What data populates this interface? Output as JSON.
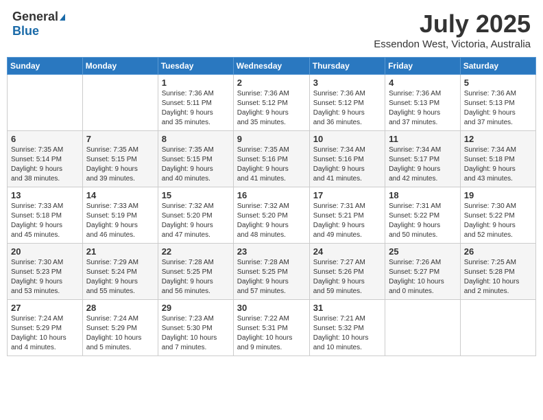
{
  "header": {
    "logo_general": "General",
    "logo_blue": "Blue",
    "month": "July 2025",
    "location": "Essendon West, Victoria, Australia"
  },
  "weekdays": [
    "Sunday",
    "Monday",
    "Tuesday",
    "Wednesday",
    "Thursday",
    "Friday",
    "Saturday"
  ],
  "weeks": [
    [
      {
        "day": "",
        "info": ""
      },
      {
        "day": "",
        "info": ""
      },
      {
        "day": "1",
        "info": "Sunrise: 7:36 AM\nSunset: 5:11 PM\nDaylight: 9 hours\nand 35 minutes."
      },
      {
        "day": "2",
        "info": "Sunrise: 7:36 AM\nSunset: 5:12 PM\nDaylight: 9 hours\nand 35 minutes."
      },
      {
        "day": "3",
        "info": "Sunrise: 7:36 AM\nSunset: 5:12 PM\nDaylight: 9 hours\nand 36 minutes."
      },
      {
        "day": "4",
        "info": "Sunrise: 7:36 AM\nSunset: 5:13 PM\nDaylight: 9 hours\nand 37 minutes."
      },
      {
        "day": "5",
        "info": "Sunrise: 7:36 AM\nSunset: 5:13 PM\nDaylight: 9 hours\nand 37 minutes."
      }
    ],
    [
      {
        "day": "6",
        "info": "Sunrise: 7:35 AM\nSunset: 5:14 PM\nDaylight: 9 hours\nand 38 minutes."
      },
      {
        "day": "7",
        "info": "Sunrise: 7:35 AM\nSunset: 5:15 PM\nDaylight: 9 hours\nand 39 minutes."
      },
      {
        "day": "8",
        "info": "Sunrise: 7:35 AM\nSunset: 5:15 PM\nDaylight: 9 hours\nand 40 minutes."
      },
      {
        "day": "9",
        "info": "Sunrise: 7:35 AM\nSunset: 5:16 PM\nDaylight: 9 hours\nand 41 minutes."
      },
      {
        "day": "10",
        "info": "Sunrise: 7:34 AM\nSunset: 5:16 PM\nDaylight: 9 hours\nand 41 minutes."
      },
      {
        "day": "11",
        "info": "Sunrise: 7:34 AM\nSunset: 5:17 PM\nDaylight: 9 hours\nand 42 minutes."
      },
      {
        "day": "12",
        "info": "Sunrise: 7:34 AM\nSunset: 5:18 PM\nDaylight: 9 hours\nand 43 minutes."
      }
    ],
    [
      {
        "day": "13",
        "info": "Sunrise: 7:33 AM\nSunset: 5:18 PM\nDaylight: 9 hours\nand 45 minutes."
      },
      {
        "day": "14",
        "info": "Sunrise: 7:33 AM\nSunset: 5:19 PM\nDaylight: 9 hours\nand 46 minutes."
      },
      {
        "day": "15",
        "info": "Sunrise: 7:32 AM\nSunset: 5:20 PM\nDaylight: 9 hours\nand 47 minutes."
      },
      {
        "day": "16",
        "info": "Sunrise: 7:32 AM\nSunset: 5:20 PM\nDaylight: 9 hours\nand 48 minutes."
      },
      {
        "day": "17",
        "info": "Sunrise: 7:31 AM\nSunset: 5:21 PM\nDaylight: 9 hours\nand 49 minutes."
      },
      {
        "day": "18",
        "info": "Sunrise: 7:31 AM\nSunset: 5:22 PM\nDaylight: 9 hours\nand 50 minutes."
      },
      {
        "day": "19",
        "info": "Sunrise: 7:30 AM\nSunset: 5:22 PM\nDaylight: 9 hours\nand 52 minutes."
      }
    ],
    [
      {
        "day": "20",
        "info": "Sunrise: 7:30 AM\nSunset: 5:23 PM\nDaylight: 9 hours\nand 53 minutes."
      },
      {
        "day": "21",
        "info": "Sunrise: 7:29 AM\nSunset: 5:24 PM\nDaylight: 9 hours\nand 55 minutes."
      },
      {
        "day": "22",
        "info": "Sunrise: 7:28 AM\nSunset: 5:25 PM\nDaylight: 9 hours\nand 56 minutes."
      },
      {
        "day": "23",
        "info": "Sunrise: 7:28 AM\nSunset: 5:25 PM\nDaylight: 9 hours\nand 57 minutes."
      },
      {
        "day": "24",
        "info": "Sunrise: 7:27 AM\nSunset: 5:26 PM\nDaylight: 9 hours\nand 59 minutes."
      },
      {
        "day": "25",
        "info": "Sunrise: 7:26 AM\nSunset: 5:27 PM\nDaylight: 10 hours\nand 0 minutes."
      },
      {
        "day": "26",
        "info": "Sunrise: 7:25 AM\nSunset: 5:28 PM\nDaylight: 10 hours\nand 2 minutes."
      }
    ],
    [
      {
        "day": "27",
        "info": "Sunrise: 7:24 AM\nSunset: 5:29 PM\nDaylight: 10 hours\nand 4 minutes."
      },
      {
        "day": "28",
        "info": "Sunrise: 7:24 AM\nSunset: 5:29 PM\nDaylight: 10 hours\nand 5 minutes."
      },
      {
        "day": "29",
        "info": "Sunrise: 7:23 AM\nSunset: 5:30 PM\nDaylight: 10 hours\nand 7 minutes."
      },
      {
        "day": "30",
        "info": "Sunrise: 7:22 AM\nSunset: 5:31 PM\nDaylight: 10 hours\nand 9 minutes."
      },
      {
        "day": "31",
        "info": "Sunrise: 7:21 AM\nSunset: 5:32 PM\nDaylight: 10 hours\nand 10 minutes."
      },
      {
        "day": "",
        "info": ""
      },
      {
        "day": "",
        "info": ""
      }
    ]
  ]
}
